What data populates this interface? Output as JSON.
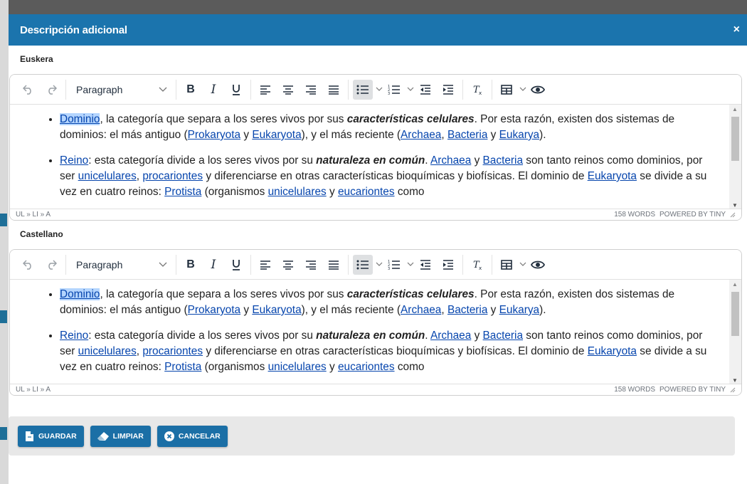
{
  "modal": {
    "title": "Descripción adicional",
    "close_glyph": "×"
  },
  "editors": [
    {
      "label": "Euskera",
      "toolbar": {
        "format_label": "Paragraph"
      },
      "paragraphs": {
        "p1_link1": "Dominio",
        "p1_t1": ", la categoría que separa a los seres vivos por sus ",
        "p1_bold": "características celulares",
        "p1_t2": ". Por esta razón, existen dos sistemas de dominios: el más antiguo (",
        "p1_link2": "Prokaryota",
        "p1_t3": " y ",
        "p1_link3": "Eukaryota",
        "p1_t4": "), y el más reciente (",
        "p1_link4": "Archaea",
        "p1_t5": ", ",
        "p1_link5": "Bacteria",
        "p1_t6": " y ",
        "p1_link6": "Eukarya",
        "p1_t7": ").",
        "p2_link1": "Reino",
        "p2_t1": ": esta categoría divide a los seres vivos por su ",
        "p2_bold": "naturaleza en común",
        "p2_t2": ". ",
        "p2_link2": "Archaea",
        "p2_t3": " y ",
        "p2_link3": "Bacteria",
        "p2_t4": " son tanto reinos como dominios, por ser ",
        "p2_link4": "unicelulares",
        "p2_t5": ", ",
        "p2_link5": "procariontes",
        "p2_t6": " y diferenciarse en otras características bioquímicas y biofísicas. El dominio de ",
        "p2_link6": "Eukaryota",
        "p2_t7": " se divide a su vez en cuatro reinos: ",
        "p2_link7": "Protista",
        "p2_t8": " (organismos ",
        "p2_link8": "unicelulares",
        "p2_t9": " y ",
        "p2_link9": "eucariontes",
        "p2_t10": " como"
      },
      "status": {
        "path": "UL » LI » A",
        "words": "158 WORDS",
        "powered": "POWERED BY TINY"
      }
    },
    {
      "label": "Castellano",
      "toolbar": {
        "format_label": "Paragraph"
      },
      "paragraphs": {
        "p1_link1": "Dominio",
        "p1_t1": ", la categoría que separa a los seres vivos por sus ",
        "p1_bold": "características celulares",
        "p1_t2": ". Por esta razón, existen dos sistemas de dominios: el más antiguo (",
        "p1_link2": "Prokaryota",
        "p1_t3": " y ",
        "p1_link3": "Eukaryota",
        "p1_t4": "), y el más reciente (",
        "p1_link4": "Archaea",
        "p1_t5": ", ",
        "p1_link5": "Bacteria",
        "p1_t6": " y ",
        "p1_link6": "Eukarya",
        "p1_t7": ").",
        "p2_link1": "Reino",
        "p2_t1": ": esta categoría divide a los seres vivos por su ",
        "p2_bold": "naturaleza en común",
        "p2_t2": ". ",
        "p2_link2": "Archaea",
        "p2_t3": " y ",
        "p2_link3": "Bacteria",
        "p2_t4": " son tanto reinos como dominios, por ser ",
        "p2_link4": "unicelulares",
        "p2_t5": ", ",
        "p2_link5": "procariontes",
        "p2_t6": " y diferenciarse en otras características bioquímicas y biofísicas. El dominio de ",
        "p2_link6": "Eukaryota",
        "p2_t7": " se divide a su vez en cuatro reinos: ",
        "p2_link7": "Protista",
        "p2_t8": " (organismos ",
        "p2_link8": "unicelulares",
        "p2_t9": " y ",
        "p2_link9": "eucariontes",
        "p2_t10": " como"
      },
      "status": {
        "path": "UL » LI » A",
        "words": "158 WORDS",
        "powered": "POWERED BY TINY"
      }
    }
  ],
  "footer": {
    "save_label": "GUARDAR",
    "clear_label": "LIMPIAR",
    "cancel_label": "CANCELAR"
  },
  "icons": {
    "undo": "undo-icon",
    "redo": "redo-icon",
    "bold": "bold-icon",
    "italic": "italic-icon",
    "underline": "underline-icon",
    "align_left": "align-left-icon",
    "align_center": "align-center-icon",
    "align_right": "align-right-icon",
    "justify": "align-justify-icon",
    "bullist": "bullet-list-icon",
    "numlist": "numbered-list-icon",
    "outdent": "outdent-icon",
    "indent": "indent-icon",
    "clear_format": "remove-format-icon",
    "table": "table-icon",
    "preview": "preview-eye-icon"
  },
  "colors": {
    "header": "#1b74ad",
    "button": "#1b6fa6",
    "link": "#0645ad",
    "selection": "#b4d5fe"
  }
}
